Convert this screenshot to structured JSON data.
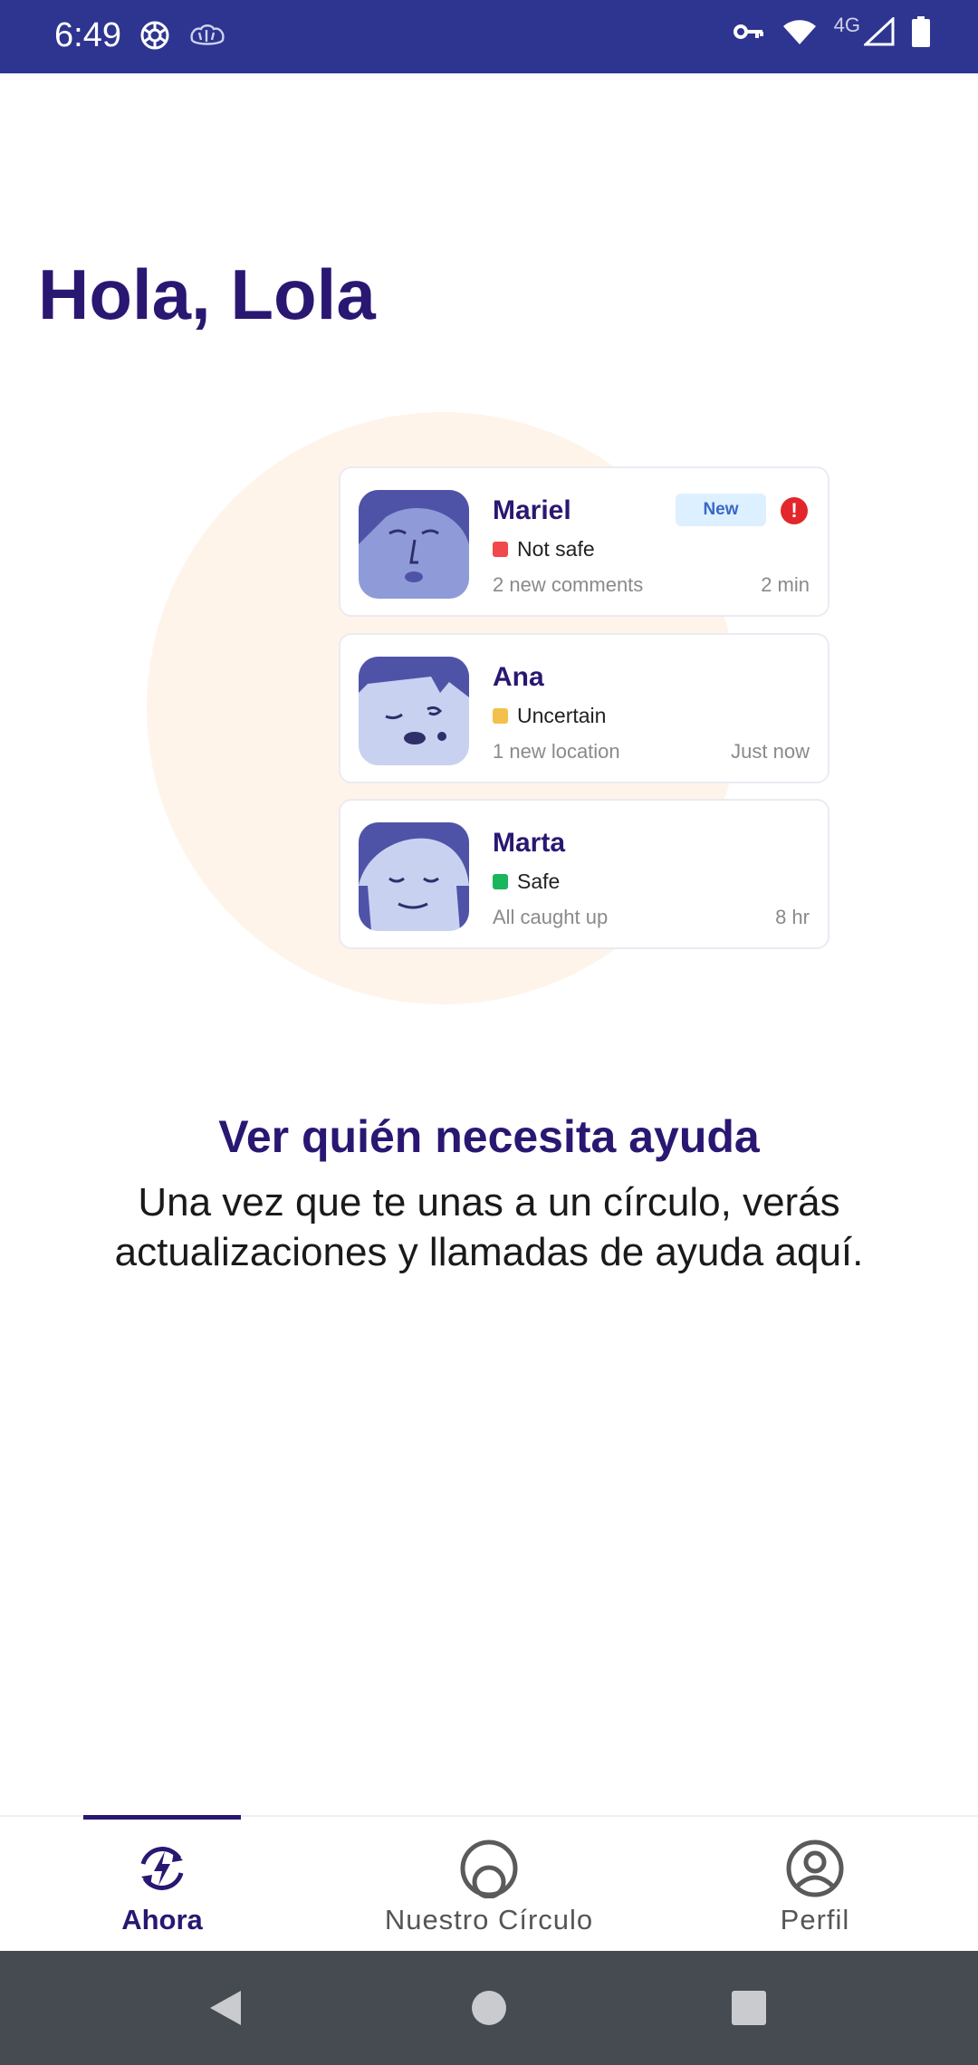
{
  "status_bar": {
    "time": "6:49",
    "network_label": "4G",
    "background": "#2E3590",
    "icons": [
      "app-icon-openai",
      "app-icon-brain",
      "vpn-key-icon",
      "wifi-icon",
      "cellular-signal-icon",
      "battery-icon"
    ]
  },
  "greeting": "Hola, Lola",
  "illustration": {
    "cards": [
      {
        "name": "Mariel",
        "status": "Not safe",
        "status_color": "#F0484B",
        "meta": "2 new comments",
        "time": "2 min",
        "badge": "New",
        "alert": "!"
      },
      {
        "name": "Ana",
        "status": "Uncertain",
        "status_color": "#F3C04B",
        "meta": "1 new location",
        "time": "Just now"
      },
      {
        "name": "Marta",
        "status": "Safe",
        "status_color": "#1BB55C",
        "meta": "All caught up",
        "time": "8 hr"
      }
    ]
  },
  "info": {
    "title": "Ver quién necesita ayuda",
    "body": "Una vez que te unas a un círculo, verás actualizaciones y llamadas de ayuda aquí."
  },
  "bottom_nav": {
    "items": [
      {
        "label": "Ahora",
        "icon": "bolt-refresh-icon",
        "active": true
      },
      {
        "label": "Nuestro Círculo",
        "icon": "circle-icon",
        "active": false
      },
      {
        "label": "Perfil",
        "icon": "profile-icon",
        "active": false
      }
    ]
  },
  "colors": {
    "primary": "#2A1772",
    "accent_bg": "#FEF4EA"
  }
}
